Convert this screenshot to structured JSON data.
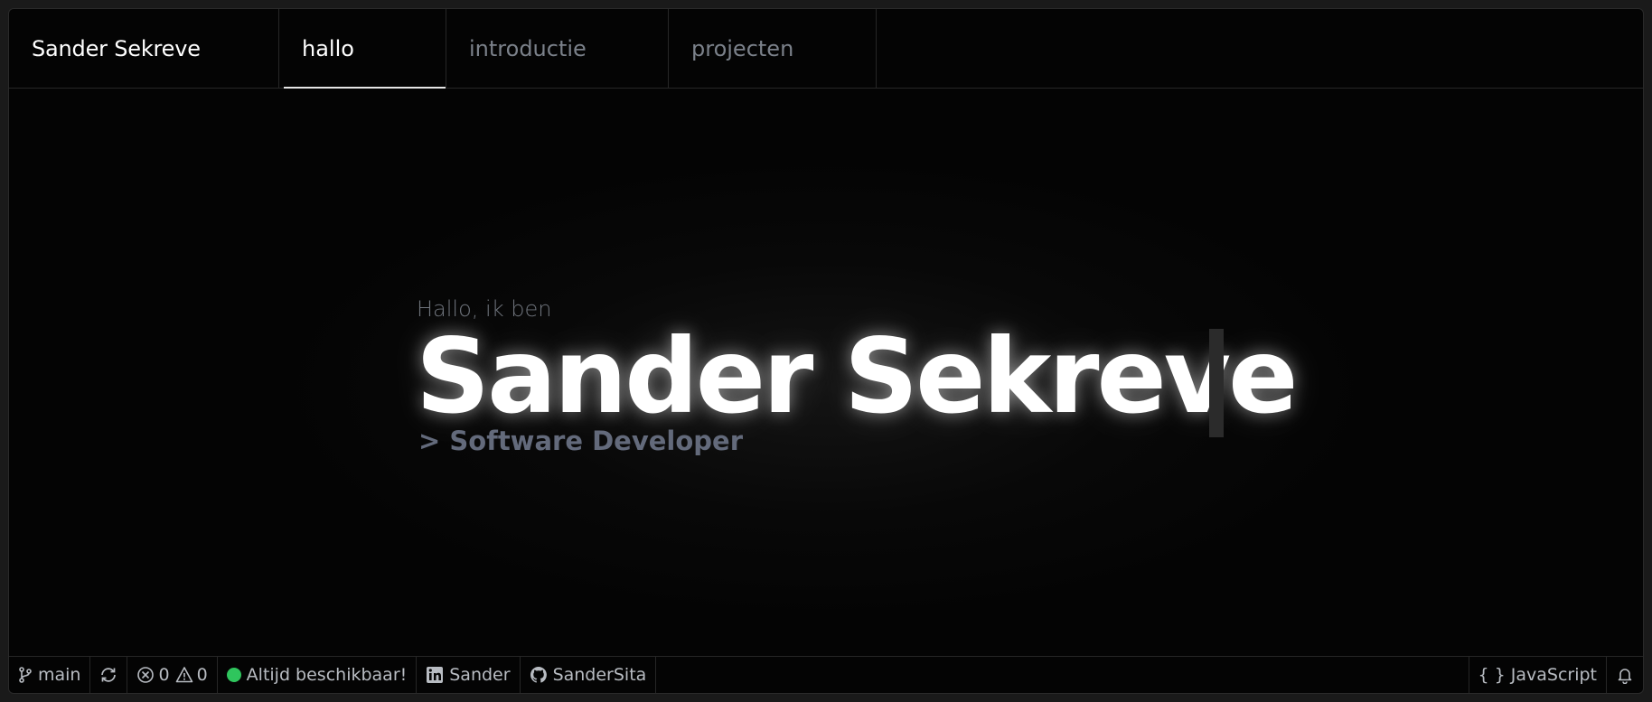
{
  "header": {
    "brand": "Sander Sekreve",
    "tabs": [
      {
        "label": "hallo",
        "active": true
      },
      {
        "label": "introductie",
        "active": false
      },
      {
        "label": "projecten",
        "active": false
      }
    ]
  },
  "hero": {
    "greeting": "Hallo, ik ben",
    "name": "Sander Sekreve",
    "role": "> Software Developer"
  },
  "statusbar": {
    "branch": "main",
    "errors": "0",
    "warnings": "0",
    "availability": "Altijd beschikbaar!",
    "linkedin": "Sander",
    "github": "SanderSita",
    "language": "JavaScript",
    "language_icon": "{ }",
    "status_color": "#2fc55d"
  }
}
